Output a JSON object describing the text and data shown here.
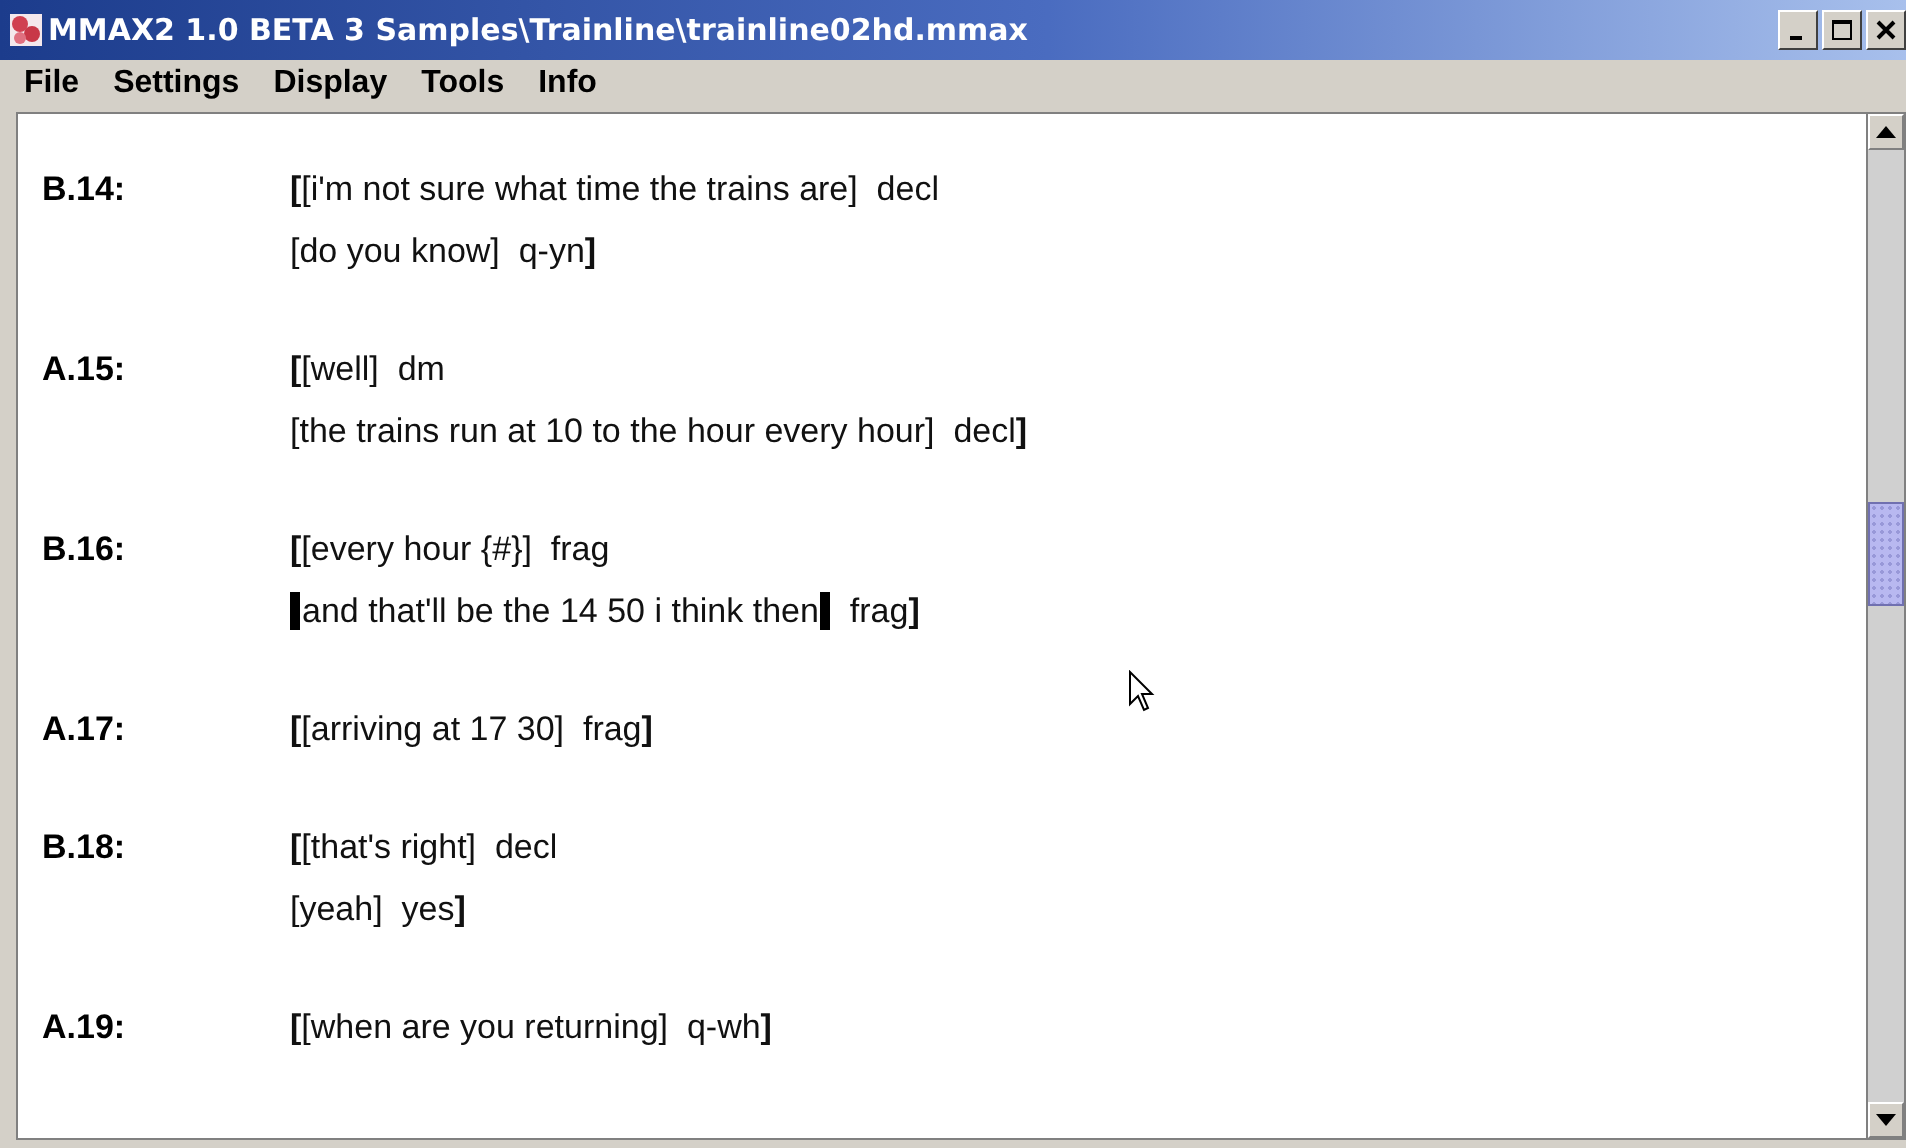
{
  "window": {
    "title": "MMAX2 1.0 BETA 3 Samples\\Trainline\\trainline02hd.mmax"
  },
  "menu": [
    "File",
    "Settings",
    "Display",
    "Tools",
    "Info"
  ],
  "utterances": [
    {
      "label": "B.14:",
      "lines": [
        [
          {
            "text": "**[**[i'm not sure what time the trains are]  decl",
            "marked": false
          }
        ],
        [
          {
            "text": "[do you know]  q-yn**]**",
            "marked": false
          }
        ]
      ]
    },
    {
      "label": "A.15:",
      "lines": [
        [
          {
            "text": "**[**[well]  dm",
            "marked": false
          }
        ],
        [
          {
            "text": "[the trains run at 10 to the hour every hour]  decl**]**",
            "marked": false
          }
        ]
      ]
    },
    {
      "label": "B.16:",
      "lines": [
        [
          {
            "text": "**[**[every hour {#}]  frag",
            "marked": false
          }
        ],
        [
          {
            "text": "and that'll be the 14 50 i think then",
            "marked": true
          },
          {
            "text": "  frag**]**",
            "marked": false
          }
        ]
      ]
    },
    {
      "label": "A.17:",
      "lines": [
        [
          {
            "text": "**[**[arriving at 17 30]  frag**]**",
            "marked": false
          }
        ]
      ]
    },
    {
      "label": "B.18:",
      "lines": [
        [
          {
            "text": "**[**[that's right]  decl",
            "marked": false
          }
        ],
        [
          {
            "text": "[yeah]  yes**]**",
            "marked": false
          }
        ]
      ]
    },
    {
      "label": "A.19:",
      "lines": [
        [
          {
            "text": "**[**[when are you returning]  q-wh**]**",
            "marked": false
          }
        ]
      ]
    }
  ]
}
